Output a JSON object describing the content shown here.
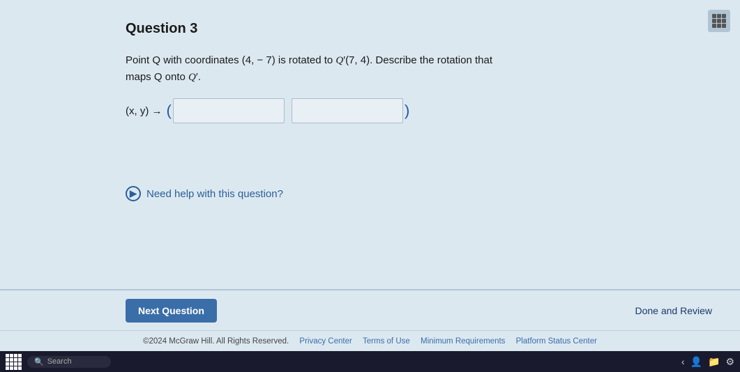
{
  "page": {
    "question_number": "Question 3",
    "question_text_line1": "Point Q with coordinates (4,  − 7) is rotated to Q′(7,  4). Describe the rotation that",
    "question_text_line2": "maps Q onto Q′.",
    "input_label": "(x, y) →",
    "input_placeholder1": "",
    "input_placeholder2": "",
    "help_text": "Need help with this question?",
    "next_button_label": "Next Question",
    "done_review_label": "Done and Review",
    "footer": {
      "copyright": "©2024 McGraw Hill. All Rights Reserved.",
      "privacy": "Privacy Center",
      "terms": "Terms of Use",
      "minimum": "Minimum Requirements",
      "platform": "Platform Status Center"
    },
    "taskbar": {
      "search_placeholder": "Search"
    }
  }
}
